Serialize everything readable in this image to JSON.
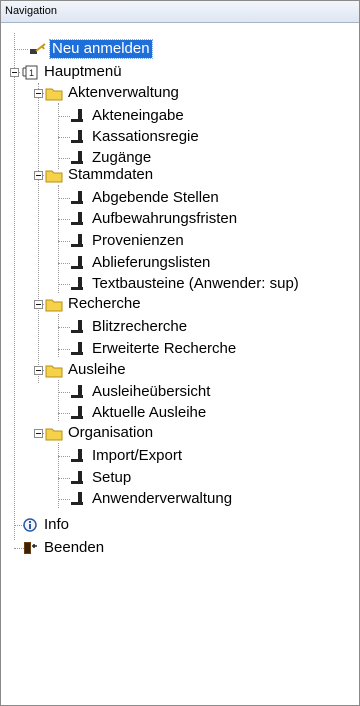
{
  "panel": {
    "title": "Navigation"
  },
  "tree": {
    "neu_anmelden": "Neu anmelden",
    "hauptmenu": "Hauptmenü",
    "aktenverwaltung": {
      "label": "Aktenverwaltung",
      "items": [
        "Akteneingabe",
        "Kassationsregie",
        "Zugänge"
      ]
    },
    "stammdaten": {
      "label": "Stammdaten",
      "items": [
        "Abgebende Stellen",
        "Aufbewahrungsfristen",
        "Provenienzen",
        "Ablieferungslisten",
        "Textbausteine (Anwender: sup)"
      ]
    },
    "recherche": {
      "label": "Recherche",
      "items": [
        "Blitzrecherche",
        "Erweiterte Recherche"
      ]
    },
    "ausleihe": {
      "label": "Ausleihe",
      "items": [
        "Ausleiheübersicht",
        "Aktuelle Ausleihe"
      ]
    },
    "organisation": {
      "label": "Organisation",
      "items": [
        "Import/Export",
        "Setup",
        "Anwenderverwaltung"
      ]
    },
    "info": "Info",
    "beenden": "Beenden"
  }
}
